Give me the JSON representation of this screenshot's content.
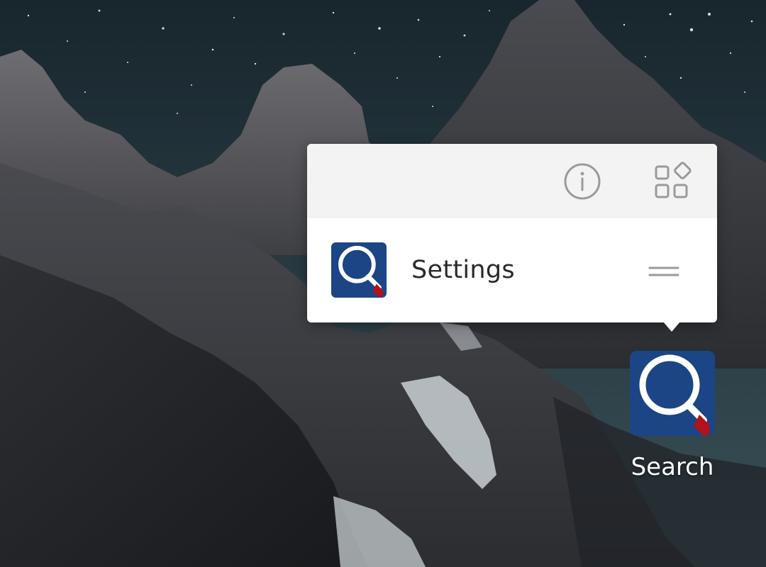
{
  "popup": {
    "header": {
      "info_icon": "info-circle-icon",
      "widgets_icon": "widgets-grid-icon"
    },
    "shortcut": {
      "label": "Settings",
      "icon": "search-magnifier-icon",
      "handle_icon": "drag-handle-icon"
    }
  },
  "desktop": {
    "app": {
      "label": "Search",
      "icon": "search-magnifier-icon"
    }
  },
  "colors": {
    "app_icon_bg": "#1b4585",
    "app_icon_handle": "#b3121b",
    "popup_bg": "#ffffff",
    "popup_header_bg": "#f3f3f3",
    "header_icon": "#9a9a9a"
  }
}
